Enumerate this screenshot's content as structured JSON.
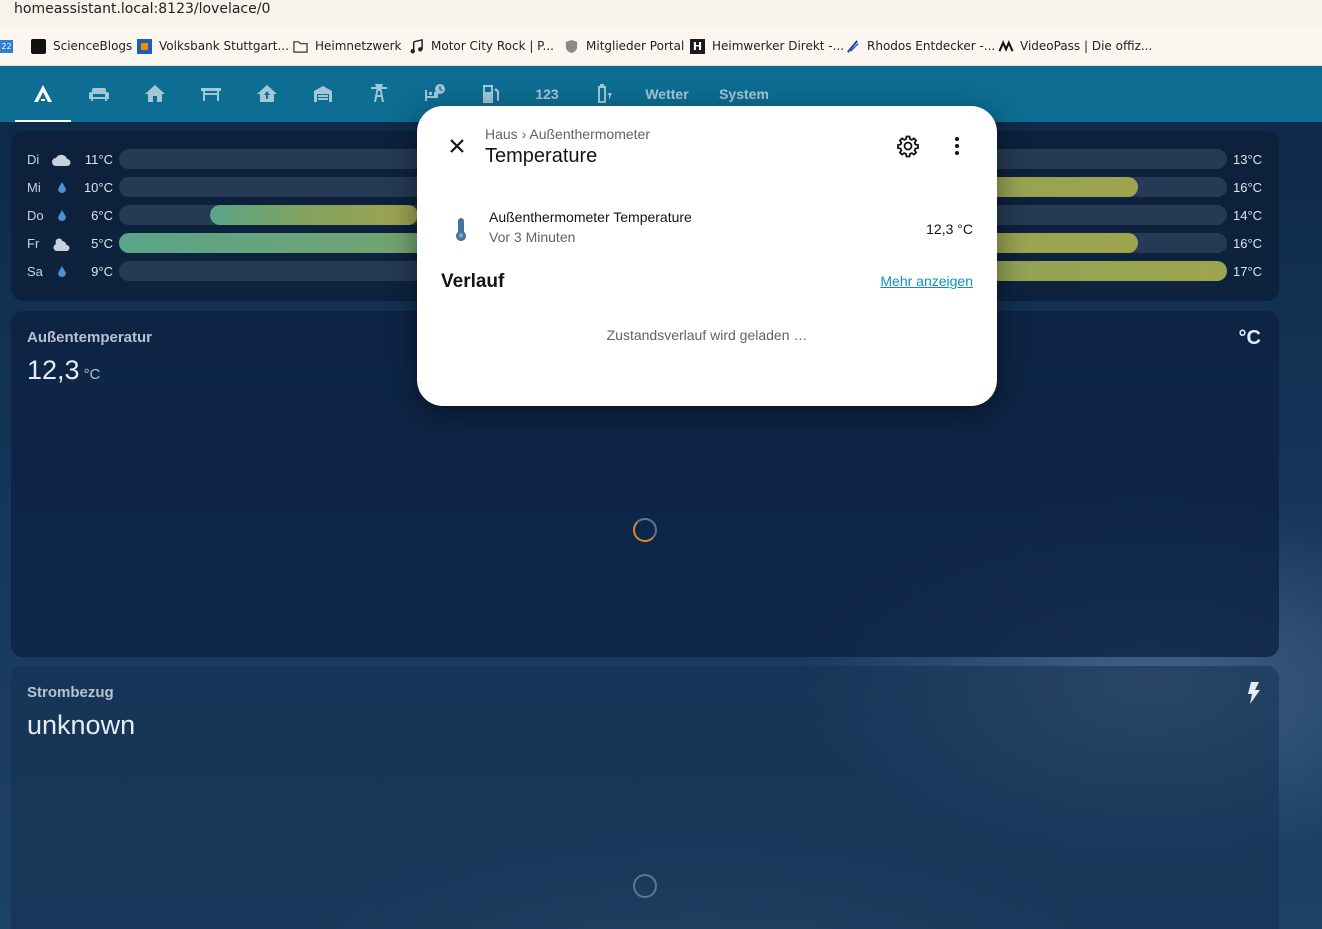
{
  "browser": {
    "url": "homeassistant.local:8123/lovelace/0",
    "bookmarks": [
      {
        "label": "ScienceBlogs",
        "icon": "scienceblogs-icon"
      },
      {
        "label": "Volksbank Stuttgart...",
        "icon": "volksbank-icon"
      },
      {
        "label": "Heimnetzwerk",
        "icon": "folder-icon"
      },
      {
        "label": "Motor City Rock | P...",
        "icon": "music-note-icon"
      },
      {
        "label": "Mitglieder Portal",
        "icon": "shield-icon"
      },
      {
        "label": "Heimwerker Direkt -...",
        "icon": "heimwerker-icon"
      },
      {
        "label": "Rhodos Entdecker -...",
        "icon": "rhodos-icon"
      },
      {
        "label": "VideoPass | Die offiz...",
        "icon": "videopass-icon"
      }
    ]
  },
  "toolbar": {
    "tabs": [
      {
        "icon": "home-assistant-icon",
        "active": true
      },
      {
        "icon": "sofa-icon"
      },
      {
        "icon": "home-icon"
      },
      {
        "icon": "table-icon"
      },
      {
        "icon": "home-upload-icon"
      },
      {
        "icon": "garage-icon"
      },
      {
        "icon": "transmission-tower-icon"
      },
      {
        "icon": "bed-clock-icon"
      },
      {
        "icon": "gas-station-icon"
      },
      {
        "label": "123"
      },
      {
        "icon": "battery-charging-icon"
      },
      {
        "label": "Wetter"
      },
      {
        "label": "System"
      }
    ]
  },
  "forecast": [
    {
      "day": "Di",
      "icon": "cloudy-icon",
      "low": "11°C",
      "high": "13°C",
      "fill_from": 0.27,
      "fill_to": 0.27
    },
    {
      "day": "Mi",
      "icon": "rain-drop-icon",
      "low": "10°C",
      "high": "16°C",
      "fill_from": 0.27,
      "fill_to": 0.92
    },
    {
      "day": "Do",
      "icon": "rain-drop-icon",
      "low": "6°C",
      "high": "14°C",
      "fill_from": 0.082,
      "fill_to": 0.27
    },
    {
      "day": "Fr",
      "icon": "partly-cloudy-icon",
      "low": "5°C",
      "high": "16°C",
      "fill_from": 0.0,
      "fill_to": 0.92
    },
    {
      "day": "Sa",
      "icon": "rain-drop-icon",
      "low": "9°C",
      "high": "17°C",
      "fill_from": 0.27,
      "fill_to": 1.0
    }
  ],
  "sensor_card": {
    "name": "Außentemperatur",
    "value": "12,3",
    "unit": "°C",
    "icon_text": "°C"
  },
  "power_card": {
    "name": "Strombezug",
    "value": "unknown",
    "icon": "flash-icon"
  },
  "dialog": {
    "breadcrumb_parent": "Haus",
    "breadcrumb_separator": "›",
    "breadcrumb_device": "Außenthermometer",
    "title": "Temperature",
    "entity_name": "Außenthermometer Temperature",
    "entity_time": "Vor 3 Minuten",
    "entity_state": "12,3 °C",
    "history_title": "Verlauf",
    "more_link": "Mehr anzeigen",
    "loading_text": "Zustandsverlauf wird geladen …"
  },
  "colors": {
    "toolbar": "#0d6d92",
    "accent_link": "#0e8fc9",
    "thermometer": "#44739e"
  }
}
